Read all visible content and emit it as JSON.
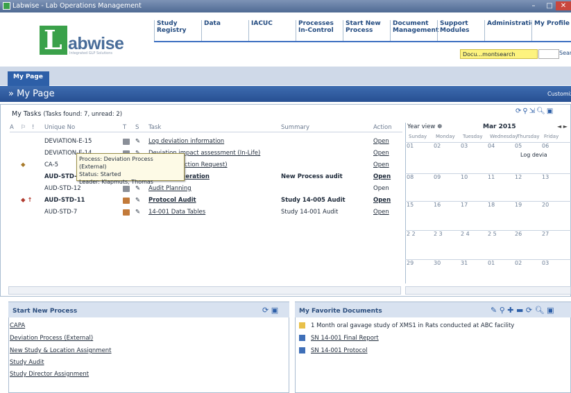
{
  "window": {
    "title": "Labwise - Lab Operations Management",
    "controls": [
      "–",
      "□",
      "✕"
    ]
  },
  "logo": {
    "letter": "L",
    "name": "abwise",
    "tagline": "Integrated GLP Solutions"
  },
  "nav": [
    {
      "label": "Study\nRegistry"
    },
    {
      "label": "Data"
    },
    {
      "label": "IACUC"
    },
    {
      "label": "Processes\nIn-Control"
    },
    {
      "label": "Start New\nProcess"
    },
    {
      "label": "Document\nManagement"
    },
    {
      "label": "Support\nModules"
    },
    {
      "label": "Administration"
    },
    {
      "label": "My Profile"
    }
  ],
  "search": {
    "scope": "Docu...montsearch",
    "link": "Sear"
  },
  "tabs": [
    {
      "label": "My Page"
    }
  ],
  "page": {
    "title": "My Page",
    "arrow": "»",
    "customize": "Customize"
  },
  "tasks": {
    "title": "My Tasks",
    "count_text": "(Tasks found: 7, unread: 2)",
    "columns": {
      "a": "A",
      "flag": "⚐",
      "prio": "!",
      "uid": "Unique No",
      "type": "T",
      "status": "S",
      "task": "Task",
      "summary": "Summary",
      "action": "Action"
    },
    "rows": [
      {
        "uid": "DEVIATION-E-15",
        "task": "Log deviation information",
        "summary": "",
        "action": "Open",
        "bold": false,
        "type_color": "#8a8f98",
        "prio": ""
      },
      {
        "uid": "DEVIATION-E-14",
        "task": "Deviation impact assessment (In-Life)",
        "summary": "",
        "action": "Open",
        "bold": false,
        "type_color": "#8a8f98",
        "prio": ""
      },
      {
        "uid": "CA-5",
        "task": "Corrective Action Request)",
        "summary": "",
        "action": "Open",
        "bold": false,
        "type_color": "#c9943a",
        "prio": "◆"
      },
      {
        "uid": "AUD-STD-",
        "task": "Report generation",
        "summary": "New Process audit",
        "action": "Open",
        "bold": true,
        "type_color": "#c27a3a",
        "prio": ""
      },
      {
        "uid": "AUD-STD-12",
        "task": "Audit Planning",
        "summary": "",
        "action": "Open",
        "bold": false,
        "type_color": "#8a8f98",
        "prio": ""
      },
      {
        "uid": "AUD-STD-11",
        "task": "Protocol Audit",
        "summary": "Study 14-005 Audit",
        "action": "Open",
        "bold": true,
        "type_color": "#c27a3a",
        "prio": "◆ ↑"
      },
      {
        "uid": "AUD-STD-7",
        "task": "14-001 Data Tables",
        "summary": "Study 14-001 Audit",
        "action": "Open",
        "bold": false,
        "type_color": "#c27a3a",
        "prio": ""
      }
    ],
    "tooltip": [
      "Process: Deviation Process (External)",
      "Status: Started",
      "Leader: Klapmuts, Thomas"
    ]
  },
  "calendar": {
    "view": "Year view ☸",
    "month": "Mar 2015",
    "nav": "◄ ►",
    "days": [
      "Sunday",
      "Monday",
      "Tuesday",
      "Wednesday",
      "Thursday",
      "Friday"
    ],
    "weeks": [
      [
        "01",
        "02",
        "03",
        "04",
        "05",
        "06"
      ],
      [
        "08",
        "09",
        "10",
        "11",
        "12",
        "13"
      ],
      [
        "15",
        "16",
        "17",
        "18",
        "19",
        "20"
      ],
      [
        "2 2",
        "2 3",
        "2 4",
        "2 5",
        "26",
        "27"
      ],
      [
        "29",
        "30",
        "31",
        "01",
        "02",
        "03"
      ]
    ],
    "event": "Log devia"
  },
  "start_process": {
    "title": "Start New Process",
    "items": [
      "CAPA",
      "Deviation Process (External)",
      "New Study & Location Assignment",
      "Study Audit",
      "Study Director Assignment"
    ]
  },
  "favorites": {
    "title": "My Favorite Documents",
    "items": [
      {
        "label": "1 Month oral gavage study of XMS1 in Rats conducted at ABC facility",
        "underline": false,
        "icon_color": "#e8c04a"
      },
      {
        "label": "SN 14-001 Final Report",
        "underline": true,
        "icon_color": "#3f6fb8"
      },
      {
        "label": "SN 14-001 Protocol",
        "underline": true,
        "icon_color": "#3f6fb8"
      }
    ]
  },
  "colors": {
    "accent": "#2d5fa8",
    "brand_green": "#3aa14a"
  }
}
